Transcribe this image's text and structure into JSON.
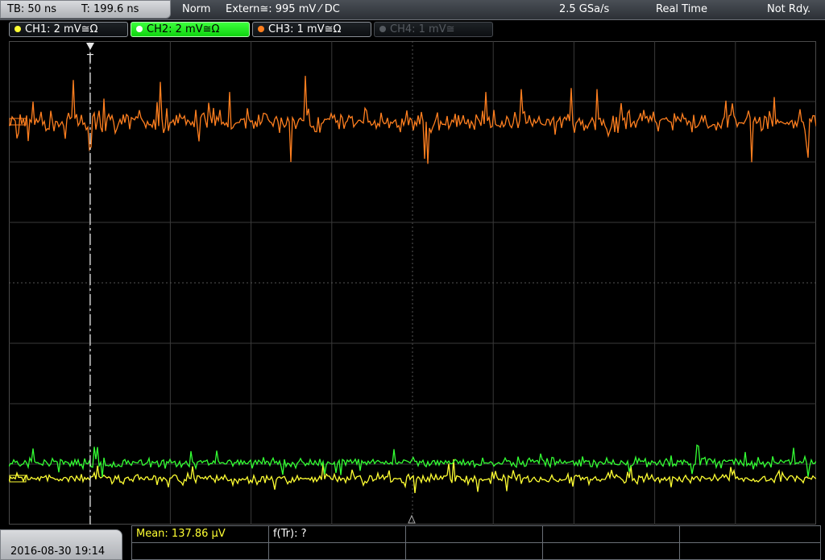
{
  "status": {
    "timebase": "TB: 50 ns",
    "trigger_time": "T: 199.6 ns",
    "trigger_mode": "Norm",
    "trigger_source": "Extern≅: 995 mV ⁄ DC",
    "sample_rate": "2.5 GSa/s",
    "acq_mode": "Real Time",
    "state": "Not Rdy."
  },
  "channels": [
    {
      "label": "CH1: 2 mV≅Ω",
      "color": "#ffff33",
      "active": false,
      "enabled": true
    },
    {
      "label": "CH2: 2 mV≅Ω",
      "color": "#33ff33",
      "active": true,
      "enabled": true
    },
    {
      "label": "CH3: 1 mV≅Ω",
      "color": "#ff7f1f",
      "active": false,
      "enabled": true
    },
    {
      "label": "CH4: 1 mV≅",
      "color": "#555a60",
      "active": false,
      "enabled": false
    }
  ],
  "trigger_marker": "T",
  "measurements": {
    "mean": "Mean: 137.86 µV",
    "rise": "f(Tr): ?"
  },
  "datetime": "2016-08-30 19:14",
  "colors": {
    "ch1": "#ffff33",
    "ch2": "#33ff33",
    "ch3": "#ff7f1f",
    "grid": "#3a3a3a",
    "meas_text": "#ffff33"
  }
}
